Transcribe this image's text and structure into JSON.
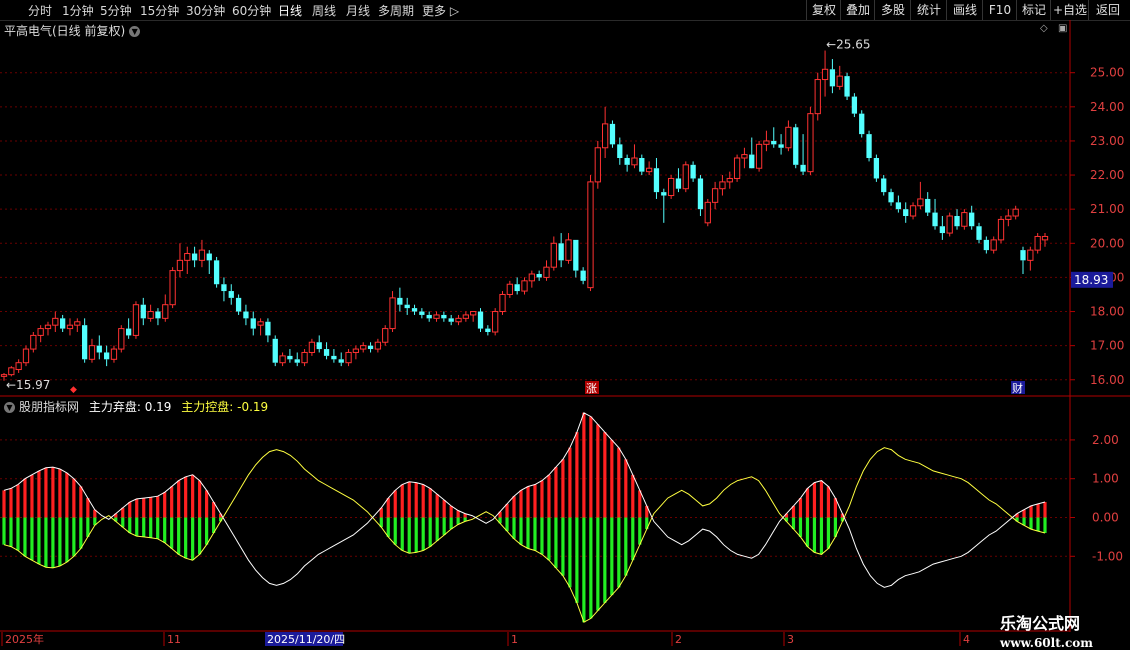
{
  "toolbar": {
    "periods": [
      "分时",
      "1分钟",
      "5分钟",
      "15分钟",
      "30分钟",
      "60分钟",
      "日线",
      "周线",
      "月线",
      "多周期",
      "更多"
    ],
    "active_period": "日线",
    "buttons": [
      "复权",
      "叠加",
      "多股",
      "统计",
      "画线",
      "F10",
      "标记",
      "+自选",
      "返回"
    ]
  },
  "main_title": "平高电气(日线 前复权)",
  "indicator": {
    "name": "股朋指标网",
    "line1_label": "主力弃盘:",
    "line1_value": "0.19",
    "line2_label": "主力控盘:",
    "line2_value": "-0.19"
  },
  "price_axis": {
    "ticks": [
      "25.00",
      "24.00",
      "23.00",
      "22.00",
      "21.00",
      "20.00",
      "19.00",
      "18.00",
      "17.00",
      "16.00"
    ],
    "current_price": "18.93"
  },
  "indicator_axis": {
    "ticks": [
      "2.00",
      "1.00",
      "0.00",
      "-1.00"
    ]
  },
  "annotations": {
    "high": "25.65",
    "low": "15.97",
    "markers": [
      "涨",
      "财"
    ]
  },
  "date_axis": {
    "labels": [
      "2025年",
      "11",
      "2025/11/20/四",
      "1",
      "2",
      "3",
      "4"
    ]
  },
  "watermark": {
    "line1": "乐淘公式网",
    "line2": "www.60lt.com"
  },
  "colors": {
    "up": "#ff3232",
    "down": "#54ffff",
    "hist_pos": "#ff2020",
    "hist_neg": "#22ee22",
    "line_ctrl": "#ffff40",
    "line_abandon": "#ffffff"
  },
  "chart_data": {
    "type": "candlestick",
    "ylim": [
      15.7,
      25.9
    ],
    "candles": [
      [
        16.1,
        16.2,
        15.97,
        16.15
      ],
      [
        16.15,
        16.4,
        16.1,
        16.35
      ],
      [
        16.3,
        16.6,
        16.2,
        16.5
      ],
      [
        16.5,
        17.0,
        16.4,
        16.9
      ],
      [
        16.9,
        17.4,
        16.8,
        17.3
      ],
      [
        17.3,
        17.6,
        17.1,
        17.5
      ],
      [
        17.5,
        17.7,
        17.3,
        17.6
      ],
      [
        17.6,
        18.0,
        17.4,
        17.8
      ],
      [
        17.8,
        17.9,
        17.4,
        17.5
      ],
      [
        17.5,
        17.8,
        17.3,
        17.6
      ],
      [
        17.6,
        17.8,
        17.4,
        17.7
      ],
      [
        17.6,
        17.8,
        16.5,
        16.6
      ],
      [
        16.6,
        17.2,
        16.5,
        17.0
      ],
      [
        17.0,
        17.3,
        16.6,
        16.8
      ],
      [
        16.8,
        17.0,
        16.4,
        16.6
      ],
      [
        16.6,
        17.0,
        16.5,
        16.9
      ],
      [
        16.9,
        17.6,
        16.8,
        17.5
      ],
      [
        17.5,
        17.8,
        17.2,
        17.3
      ],
      [
        17.3,
        18.3,
        17.2,
        18.2
      ],
      [
        18.2,
        18.4,
        17.6,
        17.8
      ],
      [
        17.8,
        18.2,
        17.7,
        18.0
      ],
      [
        18.0,
        18.1,
        17.6,
        17.8
      ],
      [
        17.8,
        18.5,
        17.7,
        18.2
      ],
      [
        18.2,
        19.3,
        18.1,
        19.2
      ],
      [
        19.2,
        20.0,
        19.0,
        19.5
      ],
      [
        19.5,
        19.9,
        19.1,
        19.7
      ],
      [
        19.7,
        19.9,
        19.3,
        19.5
      ],
      [
        19.5,
        20.1,
        19.3,
        19.8
      ],
      [
        19.7,
        19.8,
        19.1,
        19.5
      ],
      [
        19.5,
        19.6,
        18.7,
        18.8
      ],
      [
        18.8,
        19.0,
        18.3,
        18.6
      ],
      [
        18.6,
        18.8,
        18.2,
        18.4
      ],
      [
        18.4,
        18.5,
        17.9,
        18.0
      ],
      [
        18.0,
        18.2,
        17.6,
        17.8
      ],
      [
        17.8,
        18.0,
        17.3,
        17.5
      ],
      [
        17.6,
        17.8,
        17.3,
        17.7
      ],
      [
        17.7,
        17.8,
        17.1,
        17.3
      ],
      [
        17.2,
        17.3,
        16.4,
        16.5
      ],
      [
        16.5,
        16.8,
        16.4,
        16.7
      ],
      [
        16.7,
        16.9,
        16.5,
        16.6
      ],
      [
        16.6,
        16.8,
        16.4,
        16.5
      ],
      [
        16.5,
        16.9,
        16.4,
        16.8
      ],
      [
        16.8,
        17.2,
        16.7,
        17.1
      ],
      [
        17.1,
        17.3,
        16.8,
        16.9
      ],
      [
        16.9,
        17.1,
        16.6,
        16.7
      ],
      [
        16.7,
        16.9,
        16.5,
        16.6
      ],
      [
        16.6,
        16.8,
        16.4,
        16.5
      ],
      [
        16.5,
        16.9,
        16.4,
        16.8
      ],
      [
        16.8,
        17.0,
        16.6,
        16.9
      ],
      [
        16.9,
        17.1,
        16.8,
        17.0
      ],
      [
        17.0,
        17.1,
        16.8,
        16.9
      ],
      [
        16.9,
        17.2,
        16.8,
        17.1
      ],
      [
        17.1,
        17.6,
        17.0,
        17.5
      ],
      [
        17.5,
        18.6,
        17.4,
        18.4
      ],
      [
        18.4,
        18.7,
        18.0,
        18.2
      ],
      [
        18.2,
        18.4,
        17.9,
        18.1
      ],
      [
        18.1,
        18.2,
        17.9,
        18.0
      ],
      [
        18.0,
        18.1,
        17.8,
        17.9
      ],
      [
        17.9,
        18.0,
        17.7,
        17.8
      ],
      [
        17.8,
        18.0,
        17.7,
        17.9
      ],
      [
        17.9,
        18.0,
        17.7,
        17.8
      ],
      [
        17.8,
        17.9,
        17.6,
        17.7
      ],
      [
        17.7,
        17.9,
        17.6,
        17.8
      ],
      [
        17.8,
        18.0,
        17.7,
        17.9
      ],
      [
        17.9,
        18.0,
        17.7,
        18.0
      ],
      [
        18.0,
        18.1,
        17.4,
        17.5
      ],
      [
        17.5,
        17.6,
        17.3,
        17.4
      ],
      [
        17.4,
        18.1,
        17.3,
        18.0
      ],
      [
        18.0,
        18.6,
        17.9,
        18.5
      ],
      [
        18.5,
        18.9,
        18.4,
        18.8
      ],
      [
        18.8,
        19.0,
        18.5,
        18.6
      ],
      [
        18.6,
        19.0,
        18.5,
        18.9
      ],
      [
        18.9,
        19.2,
        18.7,
        19.1
      ],
      [
        19.1,
        19.2,
        18.9,
        19.0
      ],
      [
        19.0,
        19.5,
        18.9,
        19.3
      ],
      [
        19.3,
        20.2,
        19.2,
        20.0
      ],
      [
        20.0,
        20.3,
        19.3,
        19.5
      ],
      [
        19.5,
        20.3,
        19.4,
        20.1
      ],
      [
        20.1,
        20.1,
        19.0,
        19.2
      ],
      [
        19.2,
        19.3,
        18.8,
        18.9
      ],
      [
        18.7,
        22.0,
        18.6,
        21.8
      ],
      [
        21.8,
        23.0,
        21.6,
        22.8
      ],
      [
        22.8,
        24.0,
        22.5,
        23.5
      ],
      [
        23.5,
        23.6,
        22.8,
        22.9
      ],
      [
        22.9,
        23.1,
        22.3,
        22.5
      ],
      [
        22.5,
        22.6,
        22.1,
        22.3
      ],
      [
        22.3,
        22.9,
        22.2,
        22.5
      ],
      [
        22.5,
        22.6,
        22.0,
        22.1
      ],
      [
        22.1,
        22.4,
        22.0,
        22.2
      ],
      [
        22.2,
        22.5,
        21.3,
        21.5
      ],
      [
        21.5,
        21.6,
        20.6,
        21.4
      ],
      [
        21.4,
        22.0,
        21.3,
        21.9
      ],
      [
        21.9,
        22.2,
        21.5,
        21.6
      ],
      [
        21.6,
        22.4,
        21.5,
        22.3
      ],
      [
        22.3,
        22.4,
        21.8,
        21.9
      ],
      [
        21.9,
        22.0,
        20.8,
        21.0
      ],
      [
        20.6,
        21.3,
        20.5,
        21.2
      ],
      [
        21.2,
        21.8,
        21.0,
        21.6
      ],
      [
        21.6,
        22.0,
        21.4,
        21.8
      ],
      [
        21.8,
        22.1,
        21.6,
        21.9
      ],
      [
        21.9,
        22.6,
        21.8,
        22.5
      ],
      [
        22.5,
        22.8,
        22.2,
        22.6
      ],
      [
        22.6,
        23.1,
        22.4,
        22.2
      ],
      [
        22.2,
        23.0,
        22.1,
        22.9
      ],
      [
        22.9,
        23.3,
        22.7,
        23.0
      ],
      [
        23.0,
        23.4,
        22.8,
        22.9
      ],
      [
        22.9,
        23.2,
        22.6,
        22.8
      ],
      [
        22.8,
        23.6,
        22.7,
        23.4
      ],
      [
        23.4,
        23.5,
        22.2,
        22.3
      ],
      [
        22.3,
        23.2,
        22.0,
        22.1
      ],
      [
        22.1,
        24.0,
        22.0,
        23.8
      ],
      [
        23.8,
        25.0,
        23.6,
        24.8
      ],
      [
        24.8,
        25.65,
        24.3,
        25.1
      ],
      [
        25.1,
        25.4,
        24.4,
        24.6
      ],
      [
        24.6,
        25.2,
        24.5,
        24.9
      ],
      [
        24.9,
        25.0,
        24.2,
        24.3
      ],
      [
        24.3,
        24.4,
        23.7,
        23.8
      ],
      [
        23.8,
        23.9,
        23.1,
        23.2
      ],
      [
        23.2,
        23.3,
        22.4,
        22.5
      ],
      [
        22.5,
        22.6,
        21.8,
        21.9
      ],
      [
        21.9,
        22.0,
        21.4,
        21.5
      ],
      [
        21.5,
        21.6,
        21.1,
        21.2
      ],
      [
        21.2,
        21.4,
        20.9,
        21.0
      ],
      [
        21.0,
        21.2,
        20.6,
        20.8
      ],
      [
        20.8,
        21.2,
        20.7,
        21.1
      ],
      [
        21.1,
        21.8,
        21.0,
        21.3
      ],
      [
        21.3,
        21.5,
        20.8,
        20.9
      ],
      [
        20.9,
        21.3,
        20.4,
        20.5
      ],
      [
        20.5,
        20.8,
        20.1,
        20.3
      ],
      [
        20.3,
        20.9,
        20.2,
        20.8
      ],
      [
        20.8,
        21.0,
        20.4,
        20.5
      ],
      [
        20.5,
        21.0,
        20.4,
        20.9
      ],
      [
        20.9,
        21.1,
        20.4,
        20.5
      ],
      [
        20.5,
        20.6,
        20.0,
        20.1
      ],
      [
        20.1,
        20.2,
        19.7,
        19.8
      ],
      [
        19.8,
        20.2,
        19.7,
        20.1
      ],
      [
        20.1,
        20.8,
        20.0,
        20.7
      ],
      [
        20.7,
        21.0,
        20.5,
        20.8
      ],
      [
        20.8,
        21.1,
        20.7,
        21.0
      ],
      [
        19.8,
        19.9,
        19.1,
        19.5
      ],
      [
        19.5,
        19.9,
        19.2,
        19.8
      ],
      [
        19.8,
        20.3,
        19.7,
        20.2
      ],
      [
        20.1,
        20.3,
        19.9,
        20.2
      ]
    ],
    "indicator_series": [
      {
        "values": [
          0.7,
          0.75,
          0.85,
          1.0,
          1.1,
          1.2,
          1.28,
          1.3,
          1.25,
          1.15,
          1.0,
          0.8,
          0.5,
          0.2,
          0.05,
          -0.05,
          0.1,
          0.25,
          0.4,
          0.48,
          0.5,
          0.52,
          0.55,
          0.65,
          0.8,
          0.95,
          1.05,
          1.1,
          0.95,
          0.7,
          0.4,
          0.1,
          -0.2,
          -0.5,
          -0.8,
          -1.1,
          -1.35,
          -1.55,
          -1.7,
          -1.75,
          -1.7,
          -1.6,
          -1.45,
          -1.25,
          -1.1,
          -0.95,
          -0.85,
          -0.75,
          -0.65,
          -0.55,
          -0.45,
          -0.3,
          -0.15,
          0.05,
          0.25,
          0.5,
          0.7,
          0.85,
          0.92,
          0.9,
          0.85,
          0.75,
          0.6,
          0.45,
          0.3,
          0.18,
          0.1,
          0.05,
          -0.05,
          -0.15,
          -0.05,
          0.15,
          0.35,
          0.55,
          0.7,
          0.8,
          0.85,
          0.95,
          1.1,
          1.3,
          1.5,
          1.8,
          2.2,
          2.7,
          2.6,
          2.4,
          2.2,
          2.0,
          1.8,
          1.5,
          1.1,
          0.7,
          0.3,
          -0.1,
          -0.3,
          -0.5,
          -0.6,
          -0.7,
          -0.6,
          -0.45,
          -0.3,
          -0.35,
          -0.5,
          -0.7,
          -0.85,
          -0.95,
          -1.0,
          -1.05,
          -0.95,
          -0.7,
          -0.4,
          -0.1,
          0.1,
          0.3,
          0.5,
          0.75,
          0.9,
          0.95,
          0.8,
          0.5,
          0.1,
          -0.3,
          -0.8,
          -1.2,
          -1.5,
          -1.7,
          -1.8,
          -1.75,
          -1.6,
          -1.5,
          -1.45,
          -1.4,
          -1.3,
          -1.2,
          -1.15,
          -1.1,
          -1.05,
          -1.0,
          -0.9,
          -0.75,
          -0.6,
          -0.45,
          -0.35,
          -0.2,
          -0.05,
          0.1,
          0.2,
          0.3,
          0.35,
          0.4
        ]
      }
    ]
  }
}
